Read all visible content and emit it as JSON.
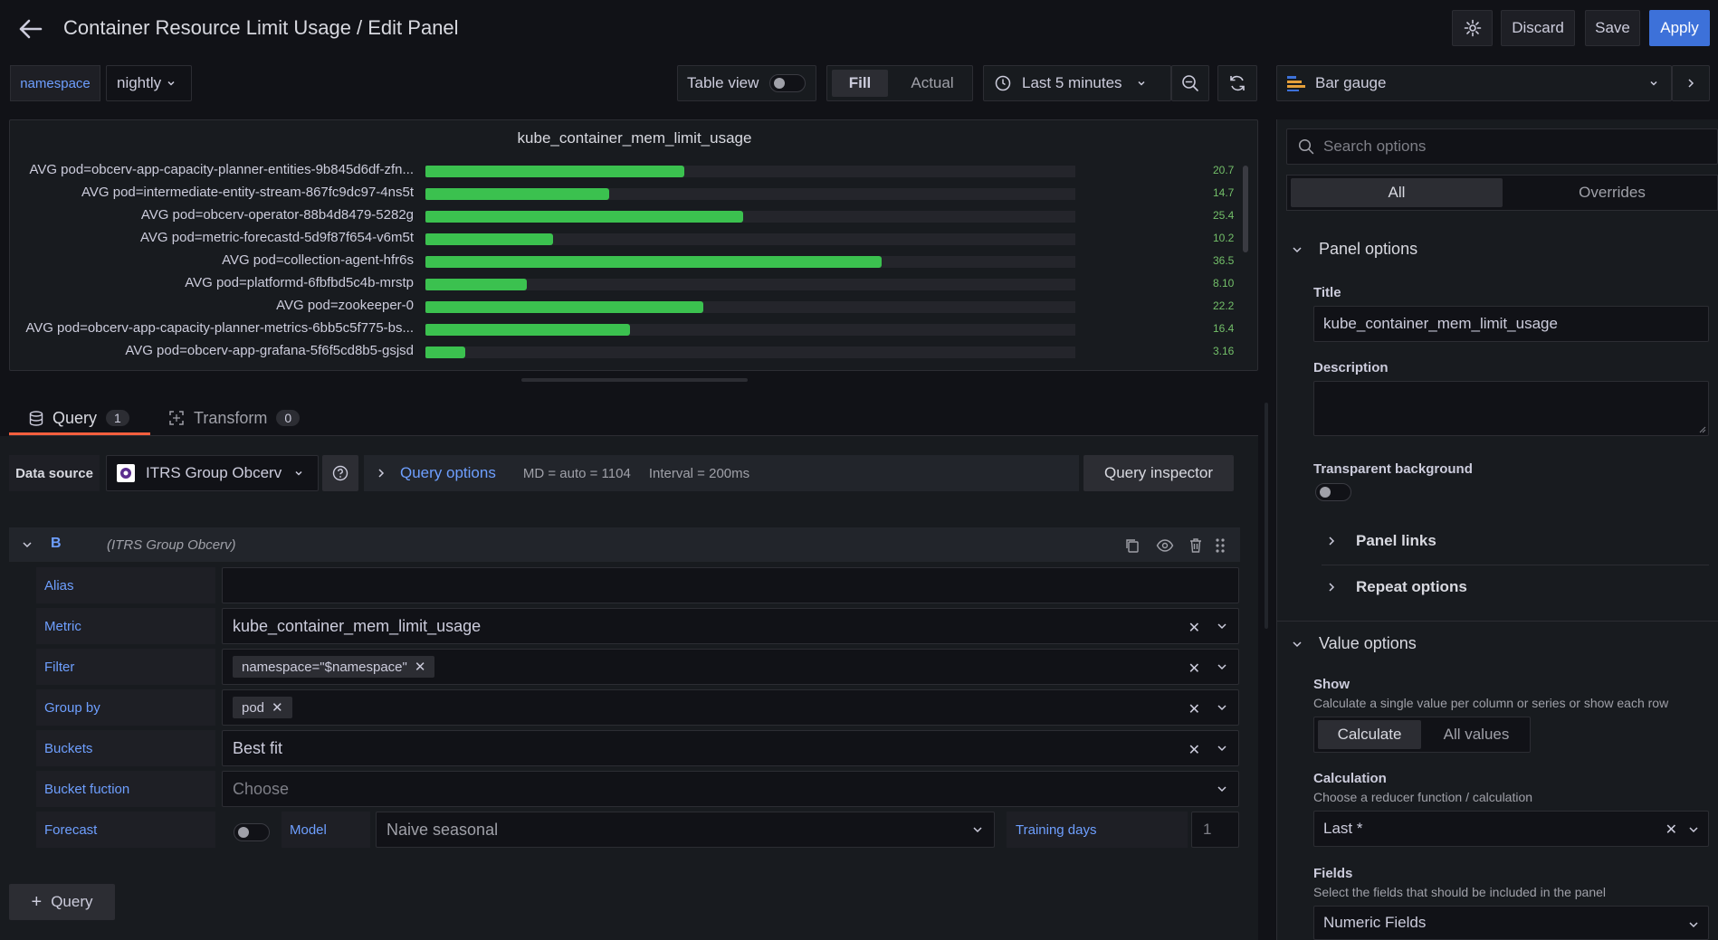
{
  "header": {
    "title": "Container Resource Limit Usage / Edit Panel",
    "discard": "Discard",
    "save": "Save",
    "apply": "Apply"
  },
  "variables": {
    "name": "namespace",
    "value": "nightly"
  },
  "toolbar": {
    "table_view": "Table view",
    "fill": "Fill",
    "actual": "Actual",
    "time_range": "Last 5 minutes"
  },
  "viz_picker": {
    "label": "Bar gauge"
  },
  "panel": {
    "title": "kube_container_mem_limit_usage",
    "rows": [
      {
        "label": "AVG pod=obcerv-app-capacity-planner-entities-9b845d6df-zfn...",
        "value": 20.7,
        "display": "20.7"
      },
      {
        "label": "AVG pod=intermediate-entity-stream-867fc9dc97-4ns5t",
        "value": 14.7,
        "display": "14.7"
      },
      {
        "label": "AVG pod=obcerv-operator-88b4d8479-5282g",
        "value": 25.4,
        "display": "25.4"
      },
      {
        "label": "AVG pod=metric-forecastd-5d9f87f654-v6m5t",
        "value": 10.2,
        "display": "10.2"
      },
      {
        "label": "AVG pod=collection-agent-hfr6s",
        "value": 36.5,
        "display": "36.5"
      },
      {
        "label": "AVG pod=platformd-6fbfbd5c4b-mrstp",
        "value": 8.1,
        "display": "8.10"
      },
      {
        "label": "AVG pod=zookeeper-0",
        "value": 22.2,
        "display": "22.2"
      },
      {
        "label": "AVG pod=obcerv-app-capacity-planner-metrics-6bb5c5f775-bs...",
        "value": 16.4,
        "display": "16.4"
      },
      {
        "label": "AVG pod=obcerv-app-grafana-5f6f5cd8b5-gsjsd",
        "value": 3.16,
        "display": "3.16"
      }
    ],
    "scale_max": 52,
    "bar_color": "#3bc14f"
  },
  "tabs": {
    "query": "Query",
    "query_count": "1",
    "transform": "Transform",
    "transform_count": "0"
  },
  "datasource": {
    "label": "Data source",
    "value": "ITRS Group Obcerv",
    "query_options": "Query options",
    "md": "MD = auto = 1104",
    "interval": "Interval = 200ms",
    "inspector": "Query inspector"
  },
  "query": {
    "ref": "B",
    "source": "(ITRS Group Obcerv)",
    "alias_label": "Alias",
    "alias_value": "",
    "metric_label": "Metric",
    "metric_value": "kube_container_mem_limit_usage",
    "filter_label": "Filter",
    "filter_chip": "namespace=\"$namespace\"",
    "groupby_label": "Group by",
    "groupby_chip": "pod",
    "buckets_label": "Buckets",
    "buckets_value": "Best fit",
    "bucketfn_label": "Bucket fuction",
    "bucketfn_placeholder": "Choose",
    "forecast_label": "Forecast",
    "model_label": "Model",
    "model_value": "Naive seasonal",
    "training_label": "Training days",
    "training_value": "1",
    "add_query": "Query"
  },
  "options": {
    "search_placeholder": "Search options",
    "tab_all": "All",
    "tab_overrides": "Overrides",
    "panel_options": "Panel options",
    "title_label": "Title",
    "title_value": "kube_container_mem_limit_usage",
    "description_label": "Description",
    "transparent_label": "Transparent background",
    "panel_links": "Panel links",
    "repeat_options": "Repeat options",
    "value_options": "Value options",
    "show_label": "Show",
    "show_desc": "Calculate a single value per column or series or show each row",
    "show_calculate": "Calculate",
    "show_all": "All values",
    "calc_label": "Calculation",
    "calc_desc": "Choose a reducer function / calculation",
    "calc_value": "Last *",
    "fields_label": "Fields",
    "fields_desc": "Select the fields that should be included in the panel",
    "fields_value": "Numeric Fields"
  }
}
